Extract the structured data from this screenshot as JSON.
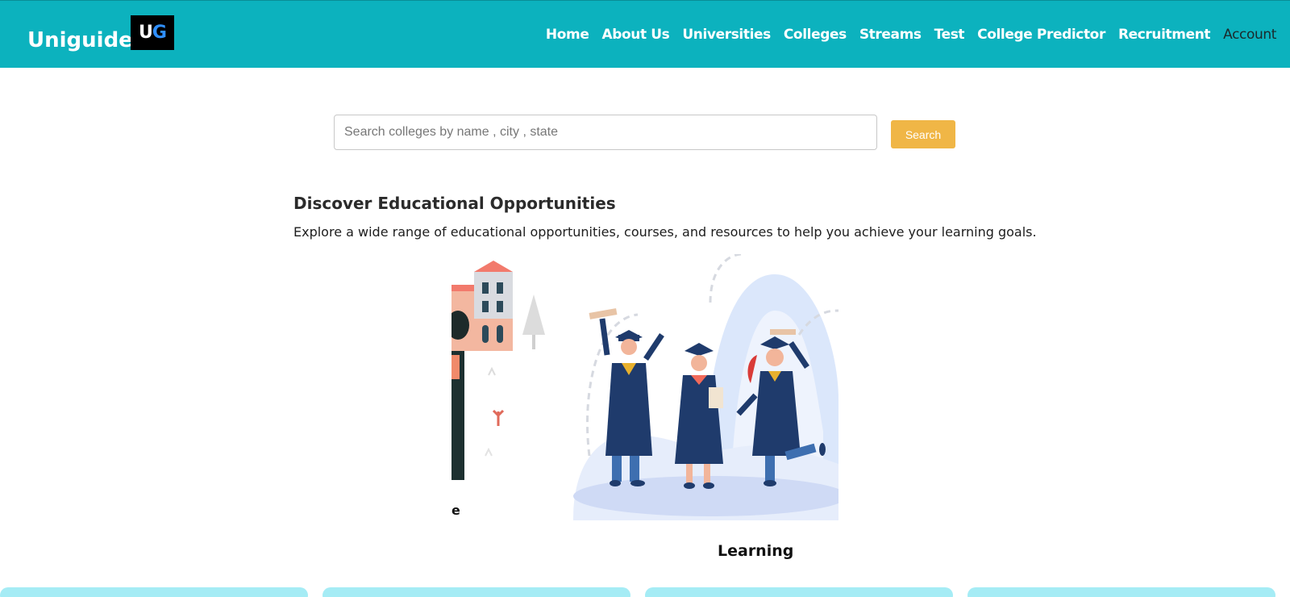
{
  "app": {
    "brand": "Uniguide",
    "logo_text": "UG"
  },
  "nav": {
    "items": [
      "Home",
      "About Us",
      "Universities",
      "Colleges",
      "Streams",
      "Test",
      "College Predictor",
      "Recruitment"
    ],
    "account": "Account"
  },
  "search": {
    "placeholder": "Search colleges by name , city , state",
    "button_label": "Search"
  },
  "section": {
    "title": "Discover Educational Opportunities",
    "description": "Explore a wide range of educational opportunities, courses, and resources to help you achieve your learning goals."
  },
  "carousel": {
    "prev_label_fragment": "e",
    "current_label": "Learning"
  },
  "colors": {
    "navbar": "#0cb2be",
    "search_button": "#f0b646",
    "card": "#a5ecf5"
  },
  "icons": [
    "logo-ug-icon",
    "campus-illustration",
    "graduates-illustration"
  ]
}
